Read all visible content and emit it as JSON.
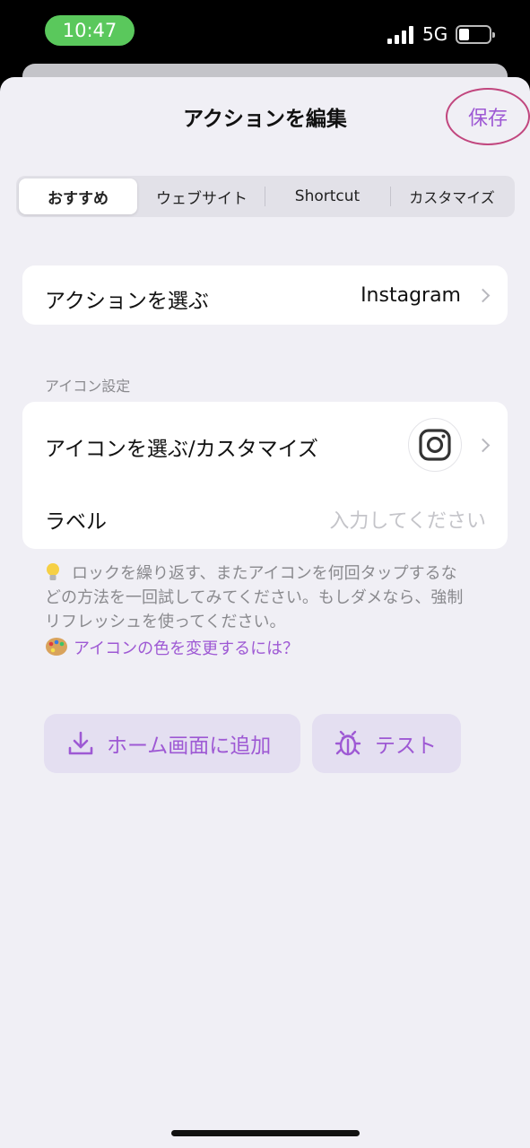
{
  "status_bar": {
    "time": "10:47",
    "network": "5G",
    "battery_level": 0.3
  },
  "header": {
    "title": "アクションを編集",
    "save_label": "保存"
  },
  "tabs": [
    {
      "label": "おすすめ",
      "active": true
    },
    {
      "label": "ウェブサイト",
      "active": false
    },
    {
      "label": "Shortcut",
      "active": false
    },
    {
      "label": "カスタマイズ",
      "active": false
    }
  ],
  "action_row": {
    "label": "アクションを選ぶ",
    "value": "Instagram"
  },
  "icon_section": {
    "header": "アイコン設定",
    "icon_row_label": "アイコンを選ぶ/カスタマイズ",
    "icon_name": "instagram-icon",
    "label_row_label": "ラベル",
    "label_placeholder": "入力してください"
  },
  "hint": {
    "icon": "lightbulb-icon",
    "lines": [
      "ロックを繰り返す、またアイコンを何回タップするな",
      "どの方法を一回試してみてください。もしダメなら、強制",
      "リフレッシュを使ってください。"
    ],
    "link_icon": "palette-icon",
    "link_text": "アイコンの色を変更するには？"
  },
  "buttons": {
    "add_home_label": "ホーム画面に追加",
    "test_label": "テスト"
  },
  "colors": {
    "accent": "#9e59d4",
    "save_circle": "#c1467e",
    "background": "#f0eff5"
  }
}
